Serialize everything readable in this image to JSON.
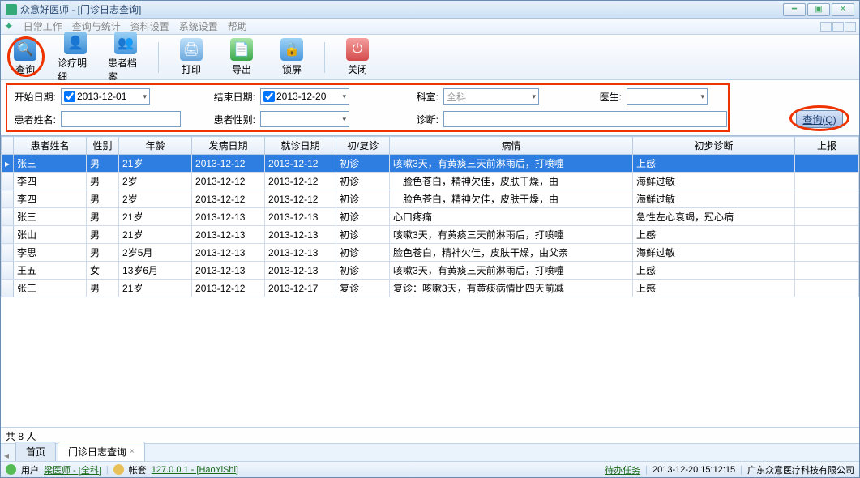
{
  "window": {
    "title": "众意好医师 - [门诊日志查询]"
  },
  "menu": {
    "items": [
      "日常工作",
      "查询与统计",
      "资料设置",
      "系统设置",
      "帮助"
    ]
  },
  "toolbar": {
    "query": "查询",
    "detail": "诊疗明细",
    "patient": "患者档案",
    "print": "打印",
    "export": "导出",
    "lock": "锁屏",
    "close": "关闭"
  },
  "filter": {
    "start_label": "开始日期:",
    "start_value": "2013-12-01",
    "end_label": "结束日期:",
    "end_value": "2013-12-20",
    "dept_label": "科室:",
    "dept_value": "全科",
    "doctor_label": "医生:",
    "doctor_value": "",
    "name_label": "患者姓名:",
    "name_value": "",
    "gender_label": "患者性别:",
    "gender_value": "",
    "diag_label": "诊断:",
    "diag_value": "",
    "query_btn": "查询(Q)"
  },
  "columns": [
    "患者姓名",
    "性别",
    "年龄",
    "发病日期",
    "就诊日期",
    "初/复诊",
    "病情",
    "初步诊断",
    "上报"
  ],
  "rows": [
    {
      "name": "张三",
      "gender": "男",
      "age": "21岁",
      "onset": "2013-12-12",
      "visit": "2013-12-12",
      "type": "初诊",
      "cond": "咳嗽3天，有黄痰三天前淋雨后，打喷嚏",
      "diag": "上感"
    },
    {
      "name": "李四",
      "gender": "男",
      "age": "2岁",
      "onset": "2013-12-12",
      "visit": "2013-12-12",
      "type": "初诊",
      "cond": "　脸色苍白，精神欠佳，皮肤干燥，由",
      "diag": "海鲜过敏"
    },
    {
      "name": "李四",
      "gender": "男",
      "age": "2岁",
      "onset": "2013-12-12",
      "visit": "2013-12-12",
      "type": "初诊",
      "cond": "　脸色苍白，精神欠佳，皮肤干燥，由",
      "diag": "海鲜过敏"
    },
    {
      "name": "张三",
      "gender": "男",
      "age": "21岁",
      "onset": "2013-12-13",
      "visit": "2013-12-13",
      "type": "初诊",
      "cond": "心口疼痛",
      "diag": "急性左心衰竭，冠心病"
    },
    {
      "name": "张山",
      "gender": "男",
      "age": "21岁",
      "onset": "2013-12-13",
      "visit": "2013-12-13",
      "type": "初诊",
      "cond": "咳嗽3天，有黄痰三天前淋雨后，打喷嚏",
      "diag": "上感"
    },
    {
      "name": "李思",
      "gender": "男",
      "age": "2岁5月",
      "onset": "2013-12-13",
      "visit": "2013-12-13",
      "type": "初诊",
      "cond": "脸色苍白，精神欠佳，皮肤干燥，由父亲",
      "diag": "海鲜过敏"
    },
    {
      "name": "王五",
      "gender": "女",
      "age": "13岁6月",
      "onset": "2013-12-13",
      "visit": "2013-12-13",
      "type": "初诊",
      "cond": "咳嗽3天，有黄痰三天前淋雨后，打喷嚏",
      "diag": "上感"
    },
    {
      "name": "张三",
      "gender": "男",
      "age": "21岁",
      "onset": "2013-12-12",
      "visit": "2013-12-17",
      "type": "复诊",
      "cond": "复诊：咳嗽3天，有黄痰病情比四天前减",
      "diag": "上感"
    }
  ],
  "summary": "共 8 人",
  "tabs": {
    "home": "首页",
    "active": "门诊日志查询"
  },
  "status": {
    "user_label": "用户",
    "user_value": "梁医师 - [全科]",
    "acct_label": "帐套",
    "acct_value": "127.0.0.1 - [HaoYiShi]",
    "todo": "待办任务",
    "datetime": "2013-12-20 15:12:15",
    "company": "广东众意医疗科技有限公司"
  }
}
